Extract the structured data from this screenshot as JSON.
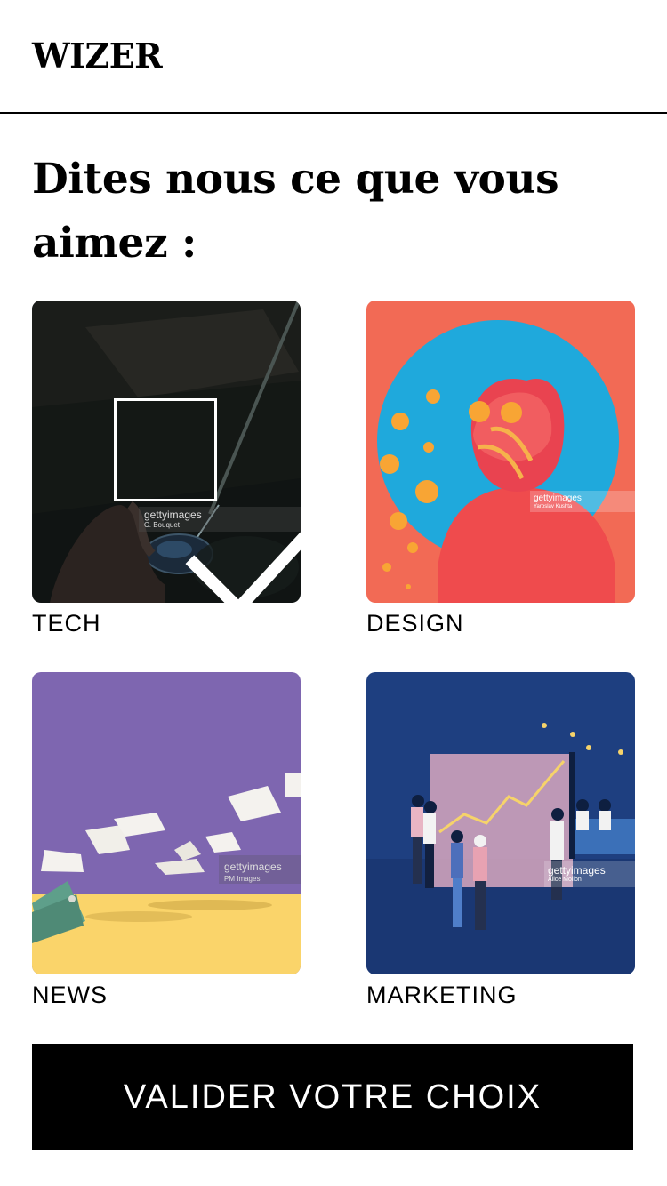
{
  "app": {
    "logo": "WIZER"
  },
  "page": {
    "title": "Dites nous ce que vous aimez :"
  },
  "categories": [
    {
      "label": "TECH",
      "selected": true,
      "watermark": "gettyimages",
      "credit": "C. Bouquet"
    },
    {
      "label": "DESIGN",
      "selected": false,
      "watermark": "gettyimages",
      "credit": "Yaroslav Kushta"
    },
    {
      "label": "NEWS",
      "selected": false,
      "watermark": "gettyimages",
      "credit": "PM Images"
    },
    {
      "label": "MARKETING",
      "selected": false,
      "watermark": "gettyimages",
      "credit": "Alice Mollon"
    }
  ],
  "cta": {
    "label": "VALIDER VOTRE CHOIX"
  },
  "colors": {
    "primary": "#000000",
    "background": "#ffffff",
    "design_bg": "#f26a55",
    "design_circle": "#1fa9dc",
    "news_bg": "#7e66b0",
    "news_floor": "#fad46a",
    "marketing_bg": "#1e3f80"
  }
}
